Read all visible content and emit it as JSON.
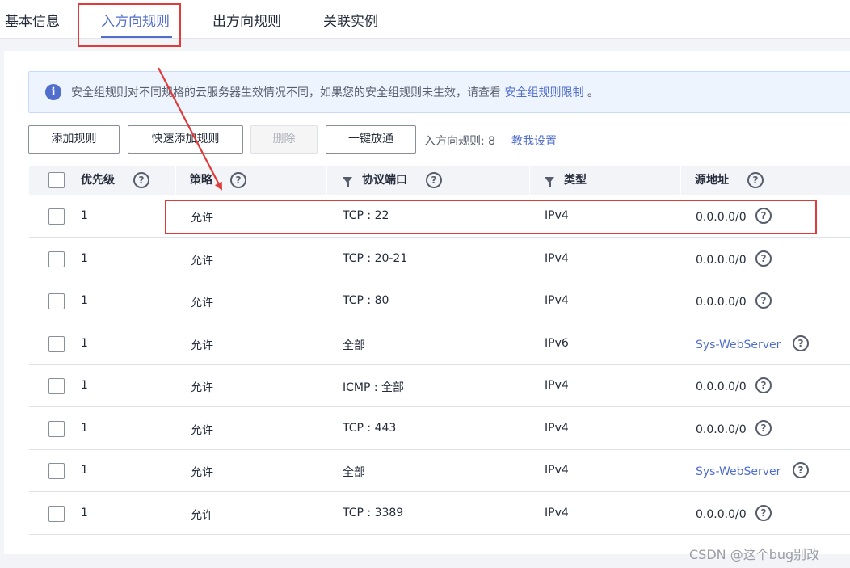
{
  "tabs": [
    {
      "label": "基本信息",
      "active": false
    },
    {
      "label": "入方向规则",
      "active": true
    },
    {
      "label": "出方向规则",
      "active": false
    },
    {
      "label": "关联实例",
      "active": false
    }
  ],
  "notice": {
    "icon": "info-icon",
    "text": "安全组规则对不同规格的云服务器生效情况不同，如果您的安全组规则未生效，请查看 ",
    "link": "安全组规则限制",
    "suffix": " 。"
  },
  "toolbar": {
    "add_rule": "添加规则",
    "quick_add_rule": "快速添加规则",
    "delete": "删除",
    "one_click_open": "一键放通",
    "rule_count_label": "入方向规则: 8",
    "help_link": "教我设置"
  },
  "table": {
    "columns": [
      "优先级",
      "策略",
      "协议端口",
      "类型",
      "源地址"
    ],
    "rows": [
      {
        "priority": "1",
        "policy": "允许",
        "protocol_port": "TCP : 22",
        "type": "IPv4",
        "source": "0.0.0.0/0",
        "source_is_link": false
      },
      {
        "priority": "1",
        "policy": "允许",
        "protocol_port": "TCP : 20-21",
        "type": "IPv4",
        "source": "0.0.0.0/0",
        "source_is_link": false
      },
      {
        "priority": "1",
        "policy": "允许",
        "protocol_port": "TCP : 80",
        "type": "IPv4",
        "source": "0.0.0.0/0",
        "source_is_link": false
      },
      {
        "priority": "1",
        "policy": "允许",
        "protocol_port": "全部",
        "type": "IPv6",
        "source": "Sys-WebServer",
        "source_is_link": true
      },
      {
        "priority": "1",
        "policy": "允许",
        "protocol_port": "ICMP : 全部",
        "type": "IPv4",
        "source": "0.0.0.0/0",
        "source_is_link": false
      },
      {
        "priority": "1",
        "policy": "允许",
        "protocol_port": "TCP : 443",
        "type": "IPv4",
        "source": "0.0.0.0/0",
        "source_is_link": false
      },
      {
        "priority": "1",
        "policy": "允许",
        "protocol_port": "全部",
        "type": "IPv4",
        "source": "Sys-WebServer",
        "source_is_link": true
      },
      {
        "priority": "1",
        "policy": "允许",
        "protocol_port": "TCP : 3389",
        "type": "IPv4",
        "source": "0.0.0.0/0",
        "source_is_link": false
      }
    ]
  },
  "help_icon_glyph": "?",
  "watermark": "CSDN @这个bug别改",
  "colors": {
    "accent": "#526ecc",
    "highlight_annotation": "#e03a3a",
    "notice_background": "#eef4fe",
    "header_background": "#f3f4f7"
  }
}
